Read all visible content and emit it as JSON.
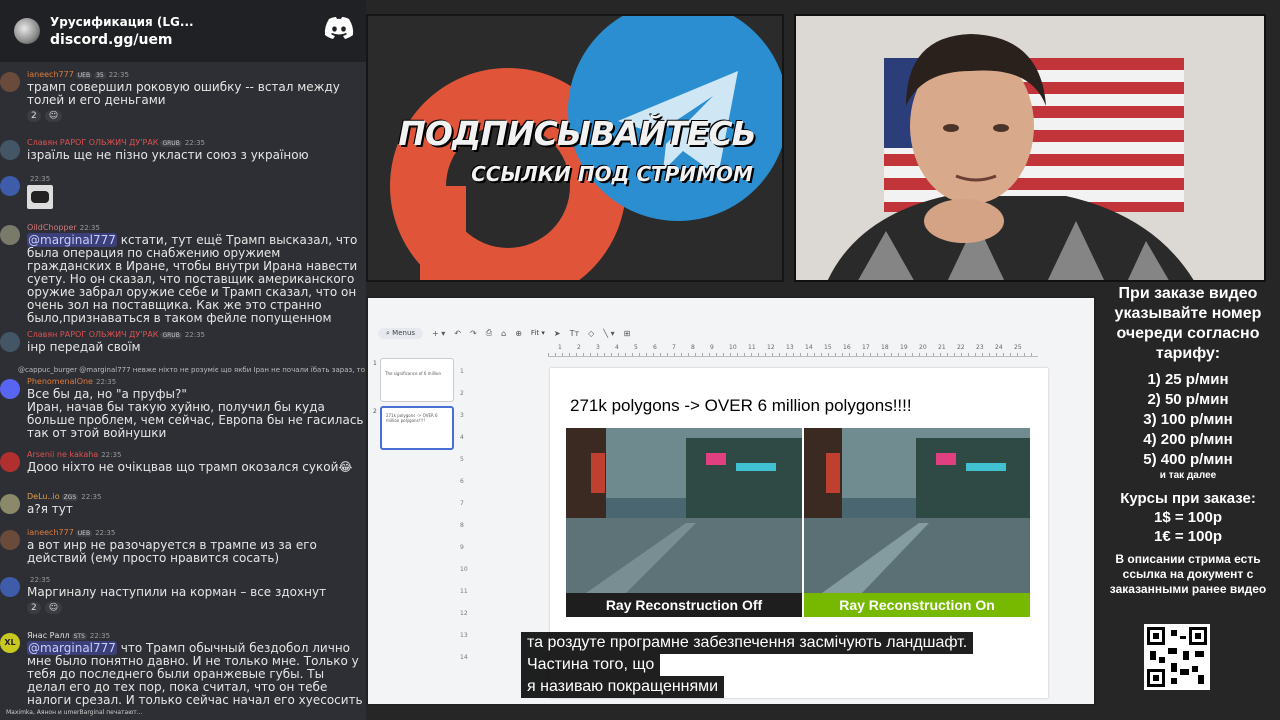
{
  "server": {
    "name": "Урусификация (LG...",
    "invite": "discord.gg/uem"
  },
  "messages": [
    {
      "user": "ianeech777",
      "user_color": "#e07a3a",
      "tags": [
        "UEB",
        "35"
      ],
      "time": "22:35",
      "text": "трамп совершил роковую ошибку -- встал между толей и его деньгами",
      "reactions": [
        "2",
        "☺"
      ]
    },
    {
      "user": "Славян РАРОГ ОЛЬЖИЧ ДУ'РАК",
      "user_color": "#e05050",
      "tags": [
        "GRUB"
      ],
      "time": "22:35",
      "text": "ізраїль ще не пізно укласти союз з україною"
    },
    {
      "user": "",
      "user_color": "#b07ad0",
      "tags": [],
      "time": "22:35",
      "text": ""
    },
    {
      "user": "OildChopper",
      "user_color": "#d07a7a",
      "tags": [],
      "time": "22:35",
      "mention": "@marginal777",
      "text": " кстати, тут ещё Трамп высказал, что была операция по снабжению оружием гражданских в Иране, чтобы внутри Ирана навести суету. Но он сказал, что поставщик американского оружие забрал оружие себе и Трамп сказал, что он очень зол на поставщика. Как же это странно было,признаваться в таком фейле попущенном"
    },
    {
      "user": "Славян РАРОГ ОЛЬЖИЧ ДУ'РАК",
      "user_color": "#e05050",
      "tags": [
        "GRUB"
      ],
      "time": "22:35",
      "text": "інр передай своїм"
    },
    {
      "reply": "@cappuc_burger @marginal777 невже ніхто не розуміє що якби Іран не почали їбать зараз, то він",
      "user": "PhenomenalOne",
      "user_color": "#e07a3a",
      "tags": [],
      "time": "22:35",
      "text": "Все бы да, но \"а пруфы?\"\nИран, начав бы такую хуйню, получил бы куда больше проблем, чем сейчас, Европа бы не гасилась так от этой войнушки"
    },
    {
      "user": "Arsenii ne kakaha",
      "user_color": "#e05050",
      "tags": [],
      "time": "22:35",
      "text": "Дооо ніхто не очікцвав що трамп окозался сукой😂"
    },
    {
      "user": "DeLu..io",
      "user_color": "#e0a050",
      "tags": [
        "ZGS"
      ],
      "time": "22:35",
      "text": "а?я тут"
    },
    {
      "user": "ianeech777",
      "user_color": "#e07a3a",
      "tags": [
        "UEB"
      ],
      "time": "22:35",
      "text": "а вот инр не разочаруется в трампе из за его действий (ему просто нравится сосать)"
    },
    {
      "user": "",
      "user_color": "#b07ad0",
      "tags": [],
      "time": "22:35",
      "text": "Маргиналу наступили на корман – все здохнут",
      "reactions": [
        "2",
        "☺"
      ]
    },
    {
      "user": "Янас Ралл",
      "user_color": "#e0e0e0",
      "tags": [
        "STS"
      ],
      "time": "22:35",
      "mention": "@marginal777",
      "text": " что Трамп обычный бездобол лично мне было понятно давно. И не только мне. Только у тебя до последнего были оранжевые губы. Ты делал его до тех пор, пока считал, что он тебе налоги срезал. И только сейчас начал его хуесосить"
    }
  ],
  "typing": "Maximka, Аянон и umerBarginal печатают...",
  "banner": {
    "line1": "ПОДПИСЫВАЙТЕСЬ",
    "line2": "ССЫЛКИ ПОД СТРИМОМ"
  },
  "slides": {
    "toolbar": {
      "menus": "Menus",
      "zoom": "Fit"
    },
    "ruler": [
      "1",
      "2",
      "3",
      "4",
      "5",
      "6",
      "7",
      "8",
      "9",
      "10",
      "11",
      "12",
      "13",
      "14",
      "15",
      "16",
      "17",
      "18",
      "19",
      "20",
      "21",
      "22",
      "23",
      "24",
      "25"
    ],
    "vruler": [
      "1",
      "2",
      "3",
      "4",
      "5",
      "6",
      "7",
      "8",
      "9",
      "10",
      "11",
      "12",
      "13",
      "14"
    ],
    "thumbs": [
      {
        "num": "1",
        "text": "The significance of 6 million"
      },
      {
        "num": "2",
        "text": "271k polygons -> OVER 6 million polygons!!!!"
      }
    ],
    "title": "271k polygons -> OVER 6 million polygons!!!!",
    "left_label": "Ray Reconstruction Off",
    "right_label": "Ray Reconstruction On",
    "left_color": "#1e1e1e",
    "right_color": "#76b900"
  },
  "subtitles": [
    "та роздуте програмне забезпечення засмічують ландшафт.",
    "Частина того, що",
    "я називаю покращеннями"
  ],
  "info": {
    "order_note": "При заказе видео указывайте номер очереди согласно тарифу:",
    "tariffs": [
      "1) 25 р/мин",
      "2) 50 р/мин",
      "3) 100 р/мин",
      "4) 200 р/мин",
      "5) 400 р/мин"
    ],
    "tariff_more": "и так далее",
    "courses_title": "Курсы при заказе:",
    "courses": [
      "1$ = 100р",
      "1€ = 100р"
    ],
    "description": "В описании стрима есть ссылка на документ с заказанными ранее видео"
  }
}
